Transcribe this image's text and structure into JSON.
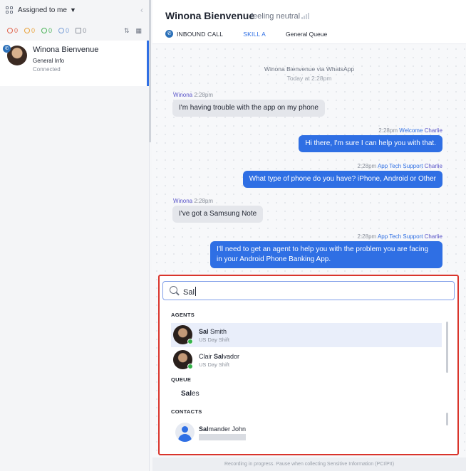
{
  "sidebar": {
    "filter_label": "Assigned to me",
    "counts": [
      "0",
      "0",
      "0",
      "0",
      "0"
    ],
    "count_colors": [
      "#e0624a",
      "#e9a23b",
      "#4cb45a",
      "#7a9fd8",
      "#8a909b"
    ],
    "conversation": {
      "name": "Winona Bienvenue",
      "subtitle": "General Info",
      "status": "Connected"
    }
  },
  "header": {
    "title": "Winona Bienvenue",
    "mood": "feeling neutral",
    "call_type": "INBOUND CALL",
    "skill": "SKILL A",
    "queue": "General Queue"
  },
  "chat": {
    "system_line": "Winona Bienvenue via WhatsApp",
    "system_time": "Today at 2:28pm",
    "messages": [
      {
        "direction": "in",
        "sender": "Winona",
        "time": "2:28pm",
        "text": "I'm having trouble with the app on my phone"
      },
      {
        "direction": "out",
        "time": "2:28pm",
        "tag": "Welcome",
        "agent": "Charlie",
        "text": "Hi there, I'm sure I can help you with that."
      },
      {
        "direction": "out",
        "time": "2:28pm",
        "tag": "App Tech Support",
        "agent": "Charlie",
        "text": "What type of phone do you have? iPhone, Android or Other"
      },
      {
        "direction": "in",
        "sender": "Winona",
        "time": "2:28pm",
        "text": "I've got a Samsung Note"
      },
      {
        "direction": "out",
        "time": "2:28pm",
        "tag": "App Tech Support",
        "agent": "Charlie",
        "text_line1": "I'll need to get an agent to help you with the problem you are facing",
        "text_line2": "in your Android Phone Banking App."
      }
    ]
  },
  "popup": {
    "search_value": "Sal",
    "agents_heading": "AGENTS",
    "agents": [
      {
        "name_match": "Sal",
        "name_rest": " Smith",
        "shift": "US Day Shift",
        "status_color": "#35b34a"
      },
      {
        "name_prefix": "Clair ",
        "name_match": "Sal",
        "name_rest": "vador",
        "shift": "US Day Shift",
        "status_color": "#35b34a"
      }
    ],
    "queue_heading": "QUEUE",
    "queue_match": "Sal",
    "queue_rest": "es",
    "contacts_heading": "CONTACTS",
    "contact_match": "Sal",
    "contact_rest": "mander John"
  },
  "footer": {
    "notice": "Recording in progress. Pause when collecting Sensitive Information (PCI/PII)"
  },
  "colors": {
    "accent": "#2f6fe4",
    "highlight_border": "#d9342b"
  }
}
